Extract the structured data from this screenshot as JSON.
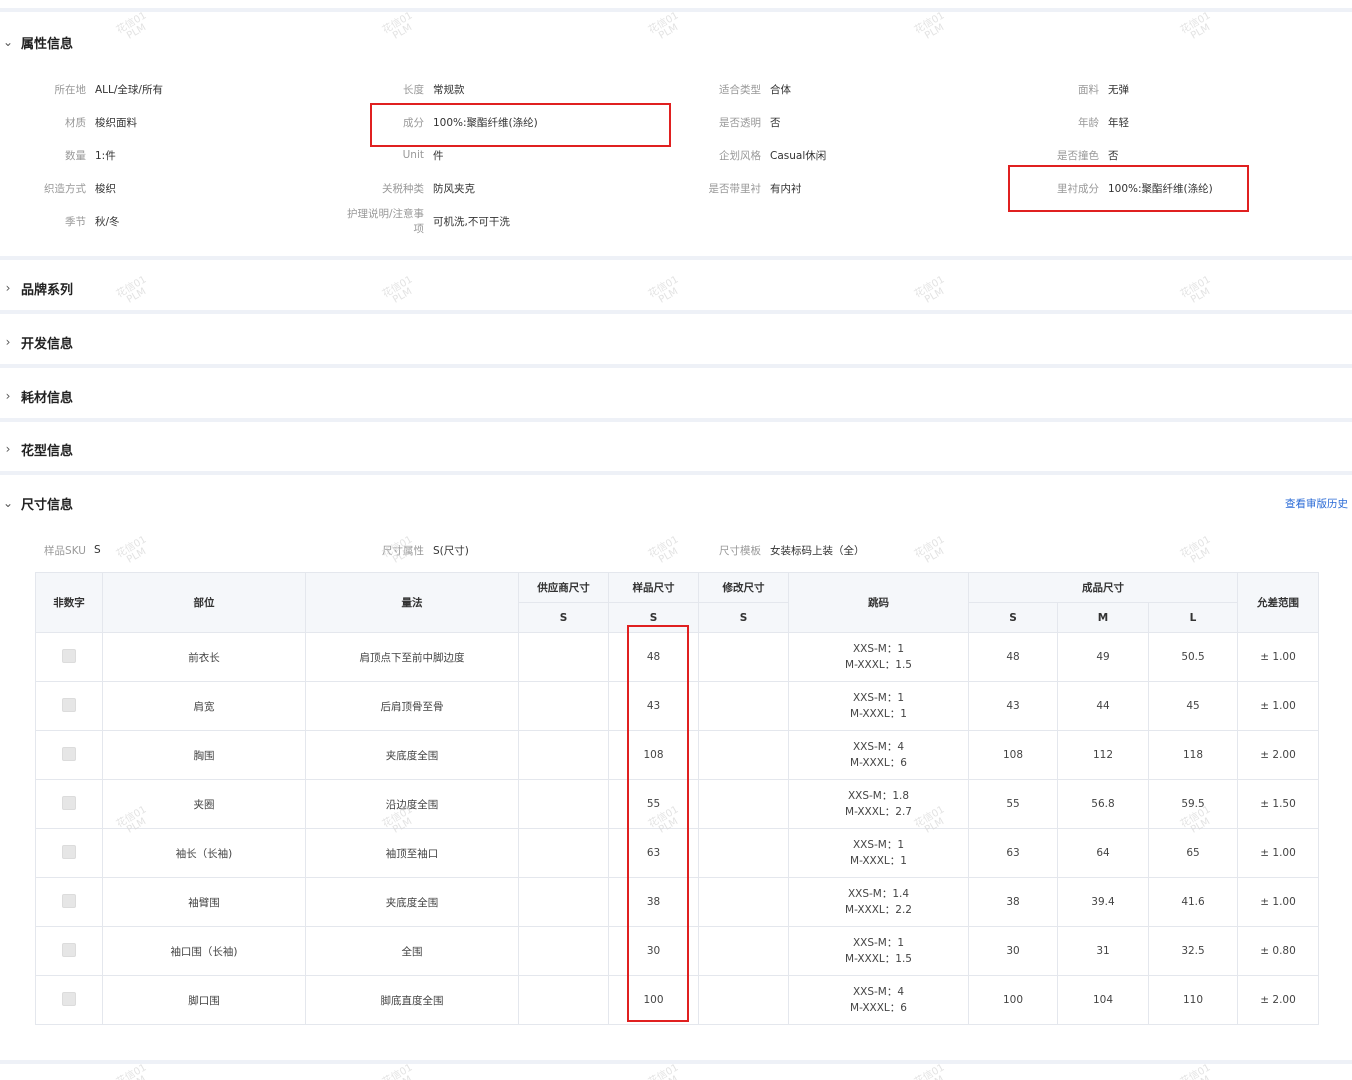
{
  "sections": {
    "attributes": {
      "title": "属性信息",
      "expanded": true
    },
    "brand_series": {
      "title": "品牌系列",
      "expanded": false
    },
    "development": {
      "title": "开发信息",
      "expanded": false
    },
    "consumables": {
      "title": "耗材信息",
      "expanded": false
    },
    "pattern": {
      "title": "花型信息",
      "expanded": false
    },
    "size": {
      "title": "尺寸信息",
      "expanded": true,
      "history_link": "查看审版历史"
    }
  },
  "icons": {
    "expanded": "chevron-down-icon",
    "collapsed": "chevron-right-icon"
  },
  "attributes": [
    [
      {
        "label": "所在地",
        "value": "ALL/全球/所有"
      },
      {
        "label": "长度",
        "value": "常规款"
      },
      {
        "label": "适合类型",
        "value": "合体"
      },
      {
        "label": "面料",
        "value": "无弹"
      }
    ],
    [
      {
        "label": "材质",
        "value": "梭织面料"
      },
      {
        "label": "成分",
        "value": "100%:聚酯纤维(涤纶)"
      },
      {
        "label": "是否透明",
        "value": "否"
      },
      {
        "label": "年龄",
        "value": "年轻"
      }
    ],
    [
      {
        "label": "数量",
        "value": "1:件"
      },
      {
        "label": "Unit",
        "value": "件"
      },
      {
        "label": "企划风格",
        "value": "Casual休闲"
      },
      {
        "label": "是否撞色",
        "value": "否"
      }
    ],
    [
      {
        "label": "织造方式",
        "value": "梭织"
      },
      {
        "label": "关税种类",
        "value": "防风夹克"
      },
      {
        "label": "是否带里衬",
        "value": "有内衬"
      },
      {
        "label": "里衬成分",
        "value": "100%:聚酯纤维(涤纶)"
      }
    ],
    [
      {
        "label": "季节",
        "value": "秋/冬"
      },
      {
        "label": "护理说明/注意事项",
        "value": "可机洗,不可干洗"
      }
    ]
  ],
  "size_meta": [
    {
      "label": "样品SKU",
      "value": "S"
    },
    {
      "label": "尺寸属性",
      "value": "S(尺寸)"
    },
    {
      "label": "尺寸模板",
      "value": "女装标码上装（全）"
    }
  ],
  "table": {
    "headers": {
      "non_numeric": "非数字",
      "part": "部位",
      "method": "量法",
      "supplier": "供应商尺寸",
      "sample": "样品尺寸",
      "modified": "修改尺寸",
      "grading": "跳码",
      "finished": "成品尺寸",
      "tolerance": "允差范围"
    },
    "sub_headers": {
      "supplier": "S",
      "sample": "S",
      "modified": "S",
      "finished": [
        "S",
        "M",
        "L"
      ]
    },
    "rows": [
      {
        "part": "前衣长",
        "method": "肩顶点下至前中脚边度",
        "supplier": "",
        "sample": "48",
        "modified": "",
        "grading": "XXS-M：1\nM-XXXL：1.5",
        "s": "48",
        "m": "49",
        "l": "50.5",
        "tol": "± 1.00"
      },
      {
        "part": "肩宽",
        "method": "后肩顶骨至骨",
        "supplier": "",
        "sample": "43",
        "modified": "",
        "grading": "XXS-M：1\nM-XXXL：1",
        "s": "43",
        "m": "44",
        "l": "45",
        "tol": "± 1.00"
      },
      {
        "part": "胸围",
        "method": "夹底度全围",
        "supplier": "",
        "sample": "108",
        "modified": "",
        "grading": "XXS-M：4\nM-XXXL：6",
        "s": "108",
        "m": "112",
        "l": "118",
        "tol": "± 2.00"
      },
      {
        "part": "夹圈",
        "method": "沿边度全围",
        "supplier": "",
        "sample": "55",
        "modified": "",
        "grading": "XXS-M：1.8\nM-XXXL：2.7",
        "s": "55",
        "m": "56.8",
        "l": "59.5",
        "tol": "± 1.50"
      },
      {
        "part": "袖长（长袖)",
        "method": "袖顶至袖口",
        "supplier": "",
        "sample": "63",
        "modified": "",
        "grading": "XXS-M：1\nM-XXXL：1",
        "s": "63",
        "m": "64",
        "l": "65",
        "tol": "± 1.00"
      },
      {
        "part": "袖臂围",
        "method": "夹底度全围",
        "supplier": "",
        "sample": "38",
        "modified": "",
        "grading": "XXS-M：1.4\nM-XXXL：2.2",
        "s": "38",
        "m": "39.4",
        "l": "41.6",
        "tol": "± 1.00"
      },
      {
        "part": "袖口围（长袖)",
        "method": "全围",
        "supplier": "",
        "sample": "30",
        "modified": "",
        "grading": "XXS-M：1\nM-XXXL：1.5",
        "s": "30",
        "m": "31",
        "l": "32.5",
        "tol": "± 0.80"
      },
      {
        "part": "脚口围",
        "method": "脚底直度全围",
        "supplier": "",
        "sample": "100",
        "modified": "",
        "grading": "XXS-M：4\nM-XXXL：6",
        "s": "100",
        "m": "104",
        "l": "110",
        "tol": "± 2.00"
      }
    ]
  },
  "watermark": "花信01\nPLM",
  "colors": {
    "highlight": "#e02020",
    "link": "#2b6bd6",
    "band": "#eef1f7"
  }
}
